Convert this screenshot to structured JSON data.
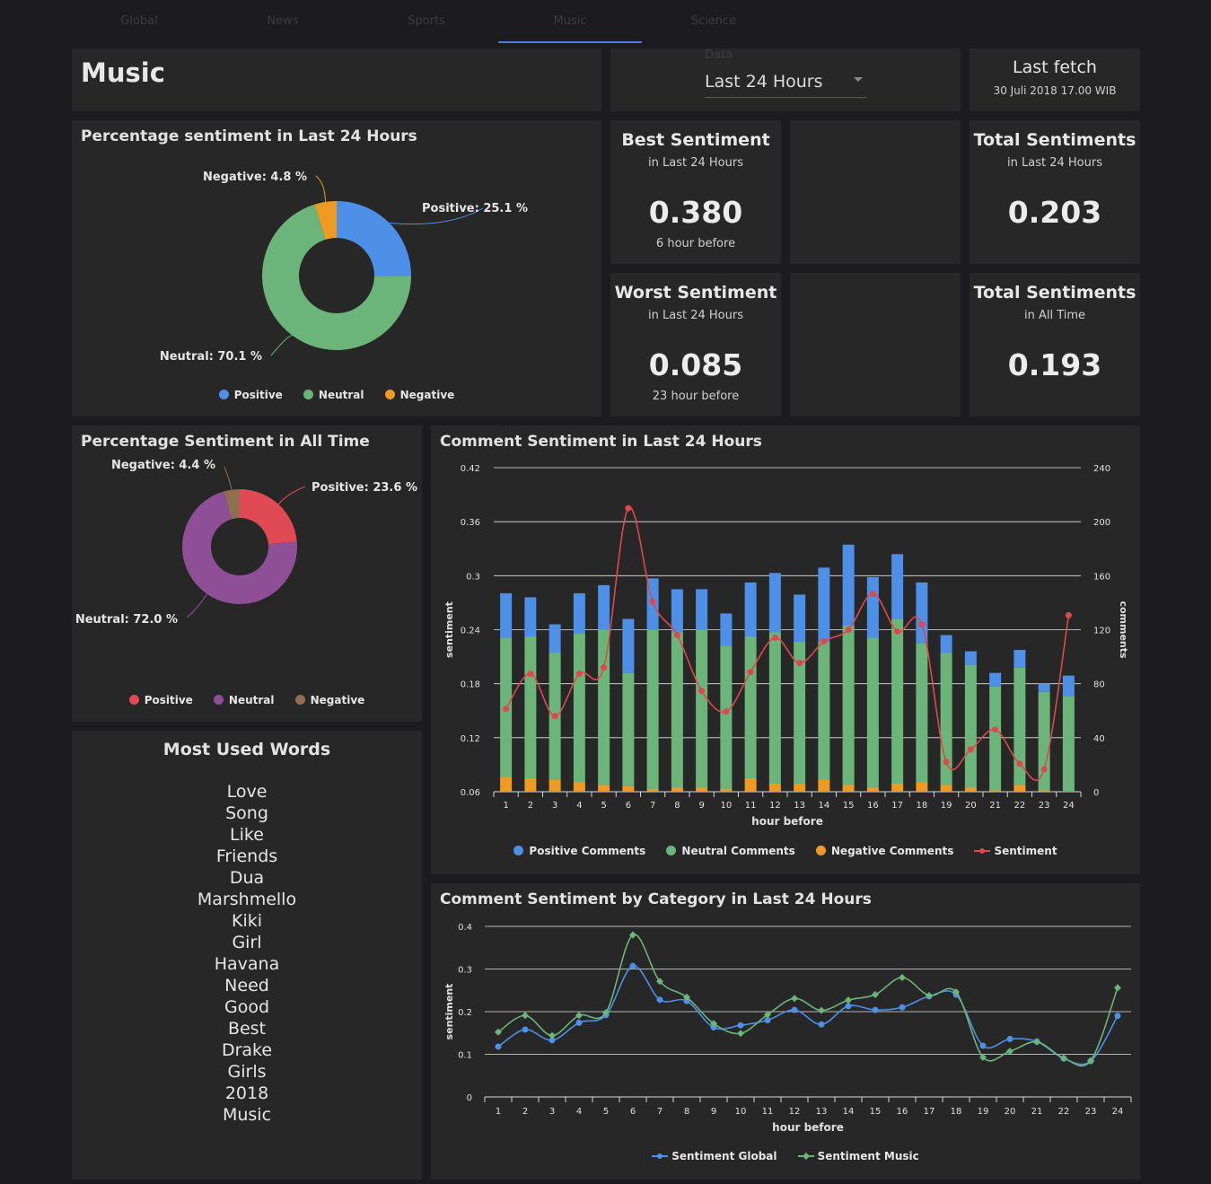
{
  "tabs": [
    {
      "label": "Global"
    },
    {
      "label": "News"
    },
    {
      "label": "Sports"
    },
    {
      "label": "Music"
    },
    {
      "label": "Science"
    }
  ],
  "active_tab": 3,
  "header": {
    "title": "Music"
  },
  "data_select": {
    "label": "Data",
    "value": "Last 24 Hours",
    "arrow_icon": "dropdown-arrow-icon"
  },
  "last_fetch": {
    "title": "Last fetch",
    "value": "30 Juli 2018 17.00 WIB"
  },
  "cards": {
    "best": {
      "title": "Best Sentiment",
      "sub": "in Last 24 Hours",
      "value": "0.380",
      "note": "6 hour before"
    },
    "worst": {
      "title": "Worst Sentiment",
      "sub": "in Last 24 Hours",
      "value": "0.085",
      "note": "23 hour before"
    },
    "total24": {
      "title": "Total Sentiments",
      "sub": "in Last 24 Hours",
      "value": "0.203"
    },
    "totalAll": {
      "title": "Total Sentiments",
      "sub": "in All Time",
      "value": "0.193"
    }
  },
  "words": {
    "title": "Most Used Words",
    "list": [
      "Love",
      "Song",
      "Like",
      "Friends",
      "Dua",
      "Marshmello",
      "Kiki",
      "Girl",
      "Havana",
      "Need",
      "Good",
      "Best",
      "Drake",
      "Girls",
      "2018",
      "Music"
    ]
  },
  "colors": {
    "positive": "#4e8fe8",
    "neutral": "#6cb57a",
    "negative": "#ef9a22",
    "sentiment": "#e0474c",
    "pos_all": "#e04a54",
    "neu_all": "#8e4f96",
    "neg_all": "#8f6f4f",
    "global": "#4e8fe8",
    "music": "#6cb57a"
  },
  "chart_data": [
    {
      "type": "pie",
      "title": "Percentage sentiment in Last 24 Hours",
      "labels": [
        "Positive",
        "Neutral",
        "Negative"
      ],
      "values": [
        25.1,
        70.1,
        4.8
      ],
      "value_labels": [
        "Positive: 25.1 %",
        "Neutral: 70.1 %",
        "Negative: 4.8 %"
      ],
      "legend": "bottom"
    },
    {
      "type": "pie",
      "title": "Percentage Sentiment in All Time",
      "labels": [
        "Positive",
        "Neutral",
        "Negative"
      ],
      "values": [
        23.6,
        72.0,
        4.4
      ],
      "value_labels": [
        "Positive: 23.6 %",
        "Neutral: 72.0 %",
        "Negative: 4.4 %"
      ],
      "legend": "bottom"
    },
    {
      "type": "bar",
      "title": "Comment Sentiment in Last 24 Hours",
      "xlabel": "hour before",
      "ylabel": "sentiment",
      "y2label": "comments",
      "categories": [
        "1",
        "2",
        "3",
        "4",
        "5",
        "6",
        "7",
        "8",
        "9",
        "10",
        "11",
        "12",
        "13",
        "14",
        "15",
        "16",
        "17",
        "18",
        "19",
        "20",
        "21",
        "22",
        "23",
        "24"
      ],
      "ylim": [
        0.06,
        0.42
      ],
      "yticks": [
        "0.06",
        "0.12",
        "0.18",
        "0.24",
        "0.3",
        "0.36",
        "0.42"
      ],
      "y2lim": [
        0,
        240
      ],
      "y2ticks": [
        "0",
        "40",
        "80",
        "120",
        "160",
        "200",
        "240"
      ],
      "stacked": true,
      "series": [
        {
          "name": "Negative Comments",
          "axis": "right",
          "values": [
            11,
            10,
            9,
            7,
            5,
            4,
            2,
            3,
            3,
            2,
            10,
            6,
            6,
            9,
            5,
            3,
            6,
            7,
            5,
            3,
            1,
            5,
            1,
            0
          ]
        },
        {
          "name": "Neutral Comments",
          "axis": "right",
          "values": [
            103,
            105,
            94,
            110,
            115,
            84,
            118,
            115,
            117,
            106,
            105,
            112,
            105,
            102,
            118,
            111,
            122,
            103,
            98,
            91,
            77,
            87,
            73,
            71
          ]
        },
        {
          "name": "Positive Comments",
          "axis": "right",
          "values": [
            33,
            29,
            21,
            30,
            33,
            40,
            38,
            32,
            30,
            24,
            40,
            44,
            35,
            55,
            60,
            45,
            48,
            45,
            13,
            10,
            10,
            13,
            6,
            15
          ]
        },
        {
          "name": "Sentiment",
          "type": "line",
          "axis": "left",
          "values": [
            0.152,
            0.191,
            0.144,
            0.191,
            0.198,
            0.375,
            0.271,
            0.234,
            0.172,
            0.149,
            0.193,
            0.231,
            0.203,
            0.227,
            0.24,
            0.28,
            0.238,
            0.246,
            0.093,
            0.107,
            0.129,
            0.091,
            0.085,
            0.256
          ]
        }
      ],
      "legend": "bottom"
    },
    {
      "type": "line",
      "title": "Comment Sentiment by Category in Last 24 Hours",
      "xlabel": "hour before",
      "ylabel": "sentiment",
      "categories": [
        "1",
        "2",
        "3",
        "4",
        "5",
        "6",
        "7",
        "8",
        "9",
        "10",
        "11",
        "12",
        "13",
        "14",
        "15",
        "16",
        "17",
        "18",
        "19",
        "20",
        "21",
        "22",
        "23",
        "24"
      ],
      "ylim": [
        0,
        0.4
      ],
      "yticks": [
        "0",
        "0.1",
        "0.2",
        "0.3",
        "0.4"
      ],
      "series": [
        {
          "name": "Sentiment Global",
          "values": [
            0.118,
            0.158,
            0.133,
            0.174,
            0.192,
            0.307,
            0.228,
            0.225,
            0.163,
            0.168,
            0.18,
            0.204,
            0.17,
            0.213,
            0.204,
            0.21,
            0.236,
            0.24,
            0.12,
            0.136,
            0.13,
            0.09,
            0.084,
            0.19
          ]
        },
        {
          "name": "Sentiment Music",
          "values": [
            0.152,
            0.191,
            0.144,
            0.191,
            0.198,
            0.38,
            0.271,
            0.234,
            0.172,
            0.149,
            0.193,
            0.231,
            0.203,
            0.227,
            0.24,
            0.28,
            0.238,
            0.246,
            0.093,
            0.107,
            0.129,
            0.091,
            0.085,
            0.256
          ]
        }
      ],
      "legend": "bottom"
    }
  ]
}
